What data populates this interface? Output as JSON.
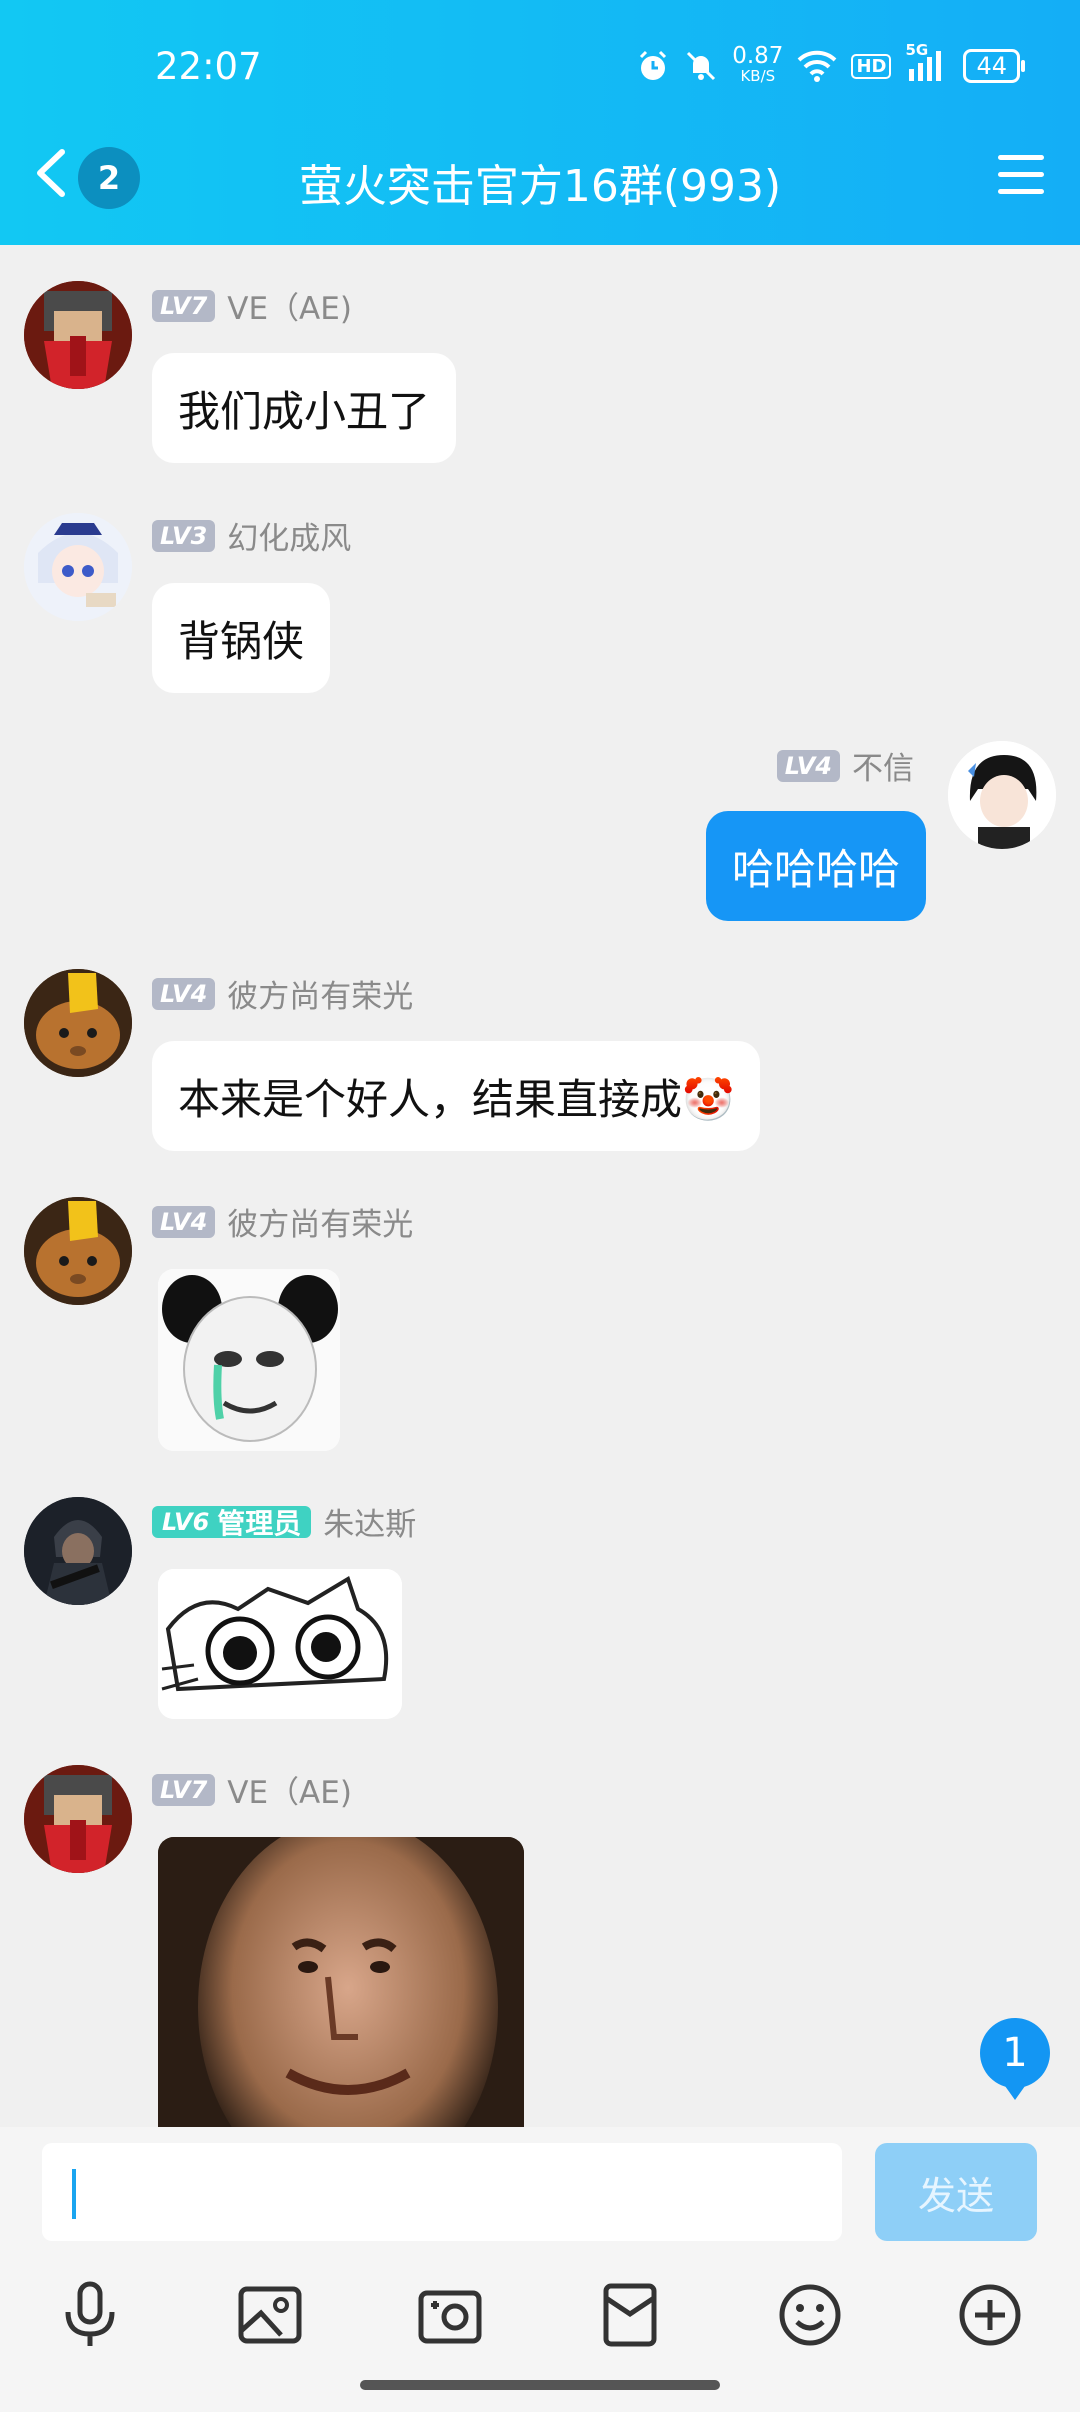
{
  "status": {
    "time": "22:07",
    "speed_value": "0.87",
    "speed_unit": "KB/S",
    "hd": "HD",
    "network": "5G",
    "battery": "44"
  },
  "header": {
    "badge": "2",
    "title": "萤火突击官方16群(993)"
  },
  "messages": [
    {
      "level": "LV7",
      "name": "VE（AE)",
      "text": "我们成小丑了"
    },
    {
      "level": "LV3",
      "name": "幻化成风",
      "text": "背锅侠"
    },
    {
      "level": "LV4",
      "name": "不信",
      "text": "哈哈哈哈"
    },
    {
      "level": "LV4",
      "name": "彼方尚有荣光",
      "text": "本来是个好人，结果直接成🤡"
    },
    {
      "level": "LV4",
      "name": "彼方尚有荣光"
    },
    {
      "level": "LV6",
      "role": "管理员",
      "name": "朱达斯"
    },
    {
      "level": "LV7",
      "name": "VE（AE)"
    }
  ],
  "unread_count": "1",
  "input": {
    "send_label": "发送"
  },
  "colors": {
    "header_start": "#12c8f3",
    "header_end": "#14aef6",
    "own_bubble": "#1696f6",
    "send_disabled": "#8ecff7"
  },
  "icons": [
    "back-icon",
    "menu-icon",
    "alarm-icon",
    "mute-icon",
    "wifi-icon",
    "signal-icon",
    "battery-icon",
    "microphone-icon",
    "image-icon",
    "camera-icon",
    "red-packet-icon",
    "emoji-icon",
    "plus-icon"
  ]
}
